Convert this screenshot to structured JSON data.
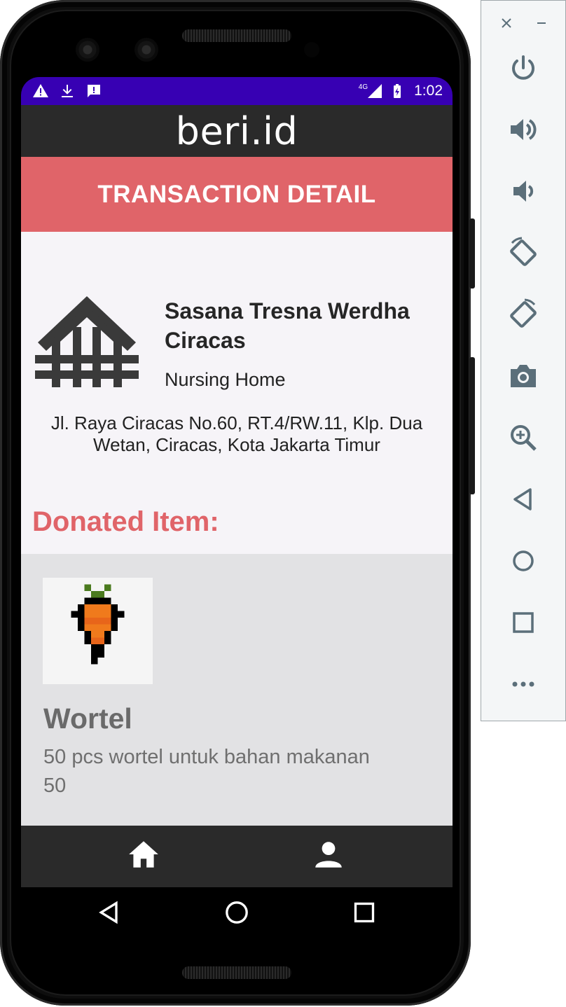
{
  "app": {
    "title": "beri.id",
    "banner": "TRANSACTION DETAIL"
  },
  "status_bar": {
    "network": "4G",
    "time": "1:02",
    "icons": [
      "warning-icon",
      "download-icon",
      "message-alert-icon",
      "signal-icon",
      "battery-icon"
    ],
    "color": "#3700b3"
  },
  "organization": {
    "name": "Sasana Tresna Werdha Ciracas",
    "type": "Nursing Home",
    "address": "Jl. Raya Ciracas No.60, RT.4/RW.11, Klp. Dua Wetan, Ciracas, Kota Jakarta Timur",
    "icon": "house-icon"
  },
  "donated": {
    "label": "Donated Item:",
    "items": [
      {
        "name": "Wortel",
        "description": "50 pcs wortel untuk bahan makanan",
        "quantity": "50",
        "icon": "carrot-icon"
      }
    ]
  },
  "bottom_nav": {
    "items": [
      "home-icon",
      "profile-icon"
    ]
  },
  "system_nav": [
    "back-icon",
    "home-circle-icon",
    "recents-icon"
  ],
  "emulator_panel": {
    "window_controls": [
      "close-icon",
      "minimize-icon"
    ],
    "tools": [
      "power-icon",
      "volume-up-icon",
      "volume-down-icon",
      "rotate-left-icon",
      "rotate-right-icon",
      "camera-icon",
      "zoom-icon",
      "back-icon",
      "home-icon",
      "overview-icon",
      "more-icon"
    ]
  },
  "colors": {
    "accent": "#e06469",
    "appbar": "#2a2a2a",
    "emulator_icon": "#5b6f7a"
  }
}
